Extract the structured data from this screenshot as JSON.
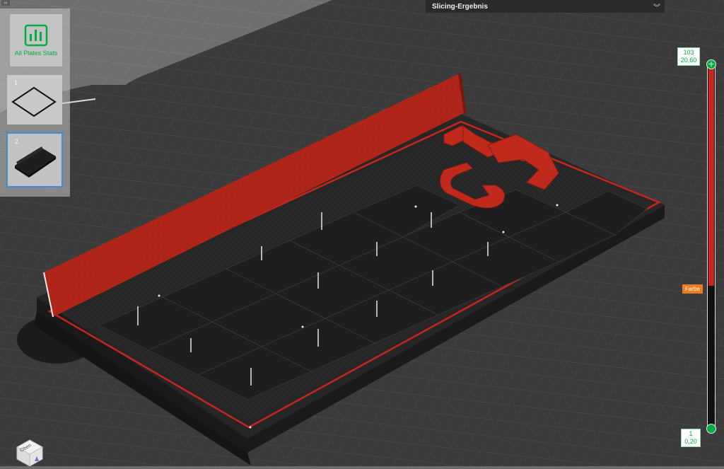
{
  "app": {
    "panel_title": "Slicing-Ergebnis"
  },
  "plates": {
    "stats_label": "All Plates Stats",
    "items": [
      {
        "number": "1",
        "state": "empty"
      },
      {
        "number": "2",
        "state": "selected"
      }
    ]
  },
  "layer_slider": {
    "top_layer": "103",
    "top_height": "20,60",
    "bottom_layer": "1",
    "bottom_height": "0,20",
    "color_badge": "Farbe"
  },
  "view_cube": {
    "face_label": "Oben"
  },
  "colors": {
    "accent": "#00ae42",
    "filament_red": "#c8261c",
    "filament_black": "#1f1f1f",
    "bed": "#3a3a3a",
    "selection_blue": "#3a8fd6",
    "badge_orange": "#ee7b1d"
  },
  "icons": {
    "stats": "bar-chart-icon",
    "collapse": "collapse-icon",
    "header_toggle": "double-chevron-down-icon",
    "slider_add": "plus-icon"
  }
}
